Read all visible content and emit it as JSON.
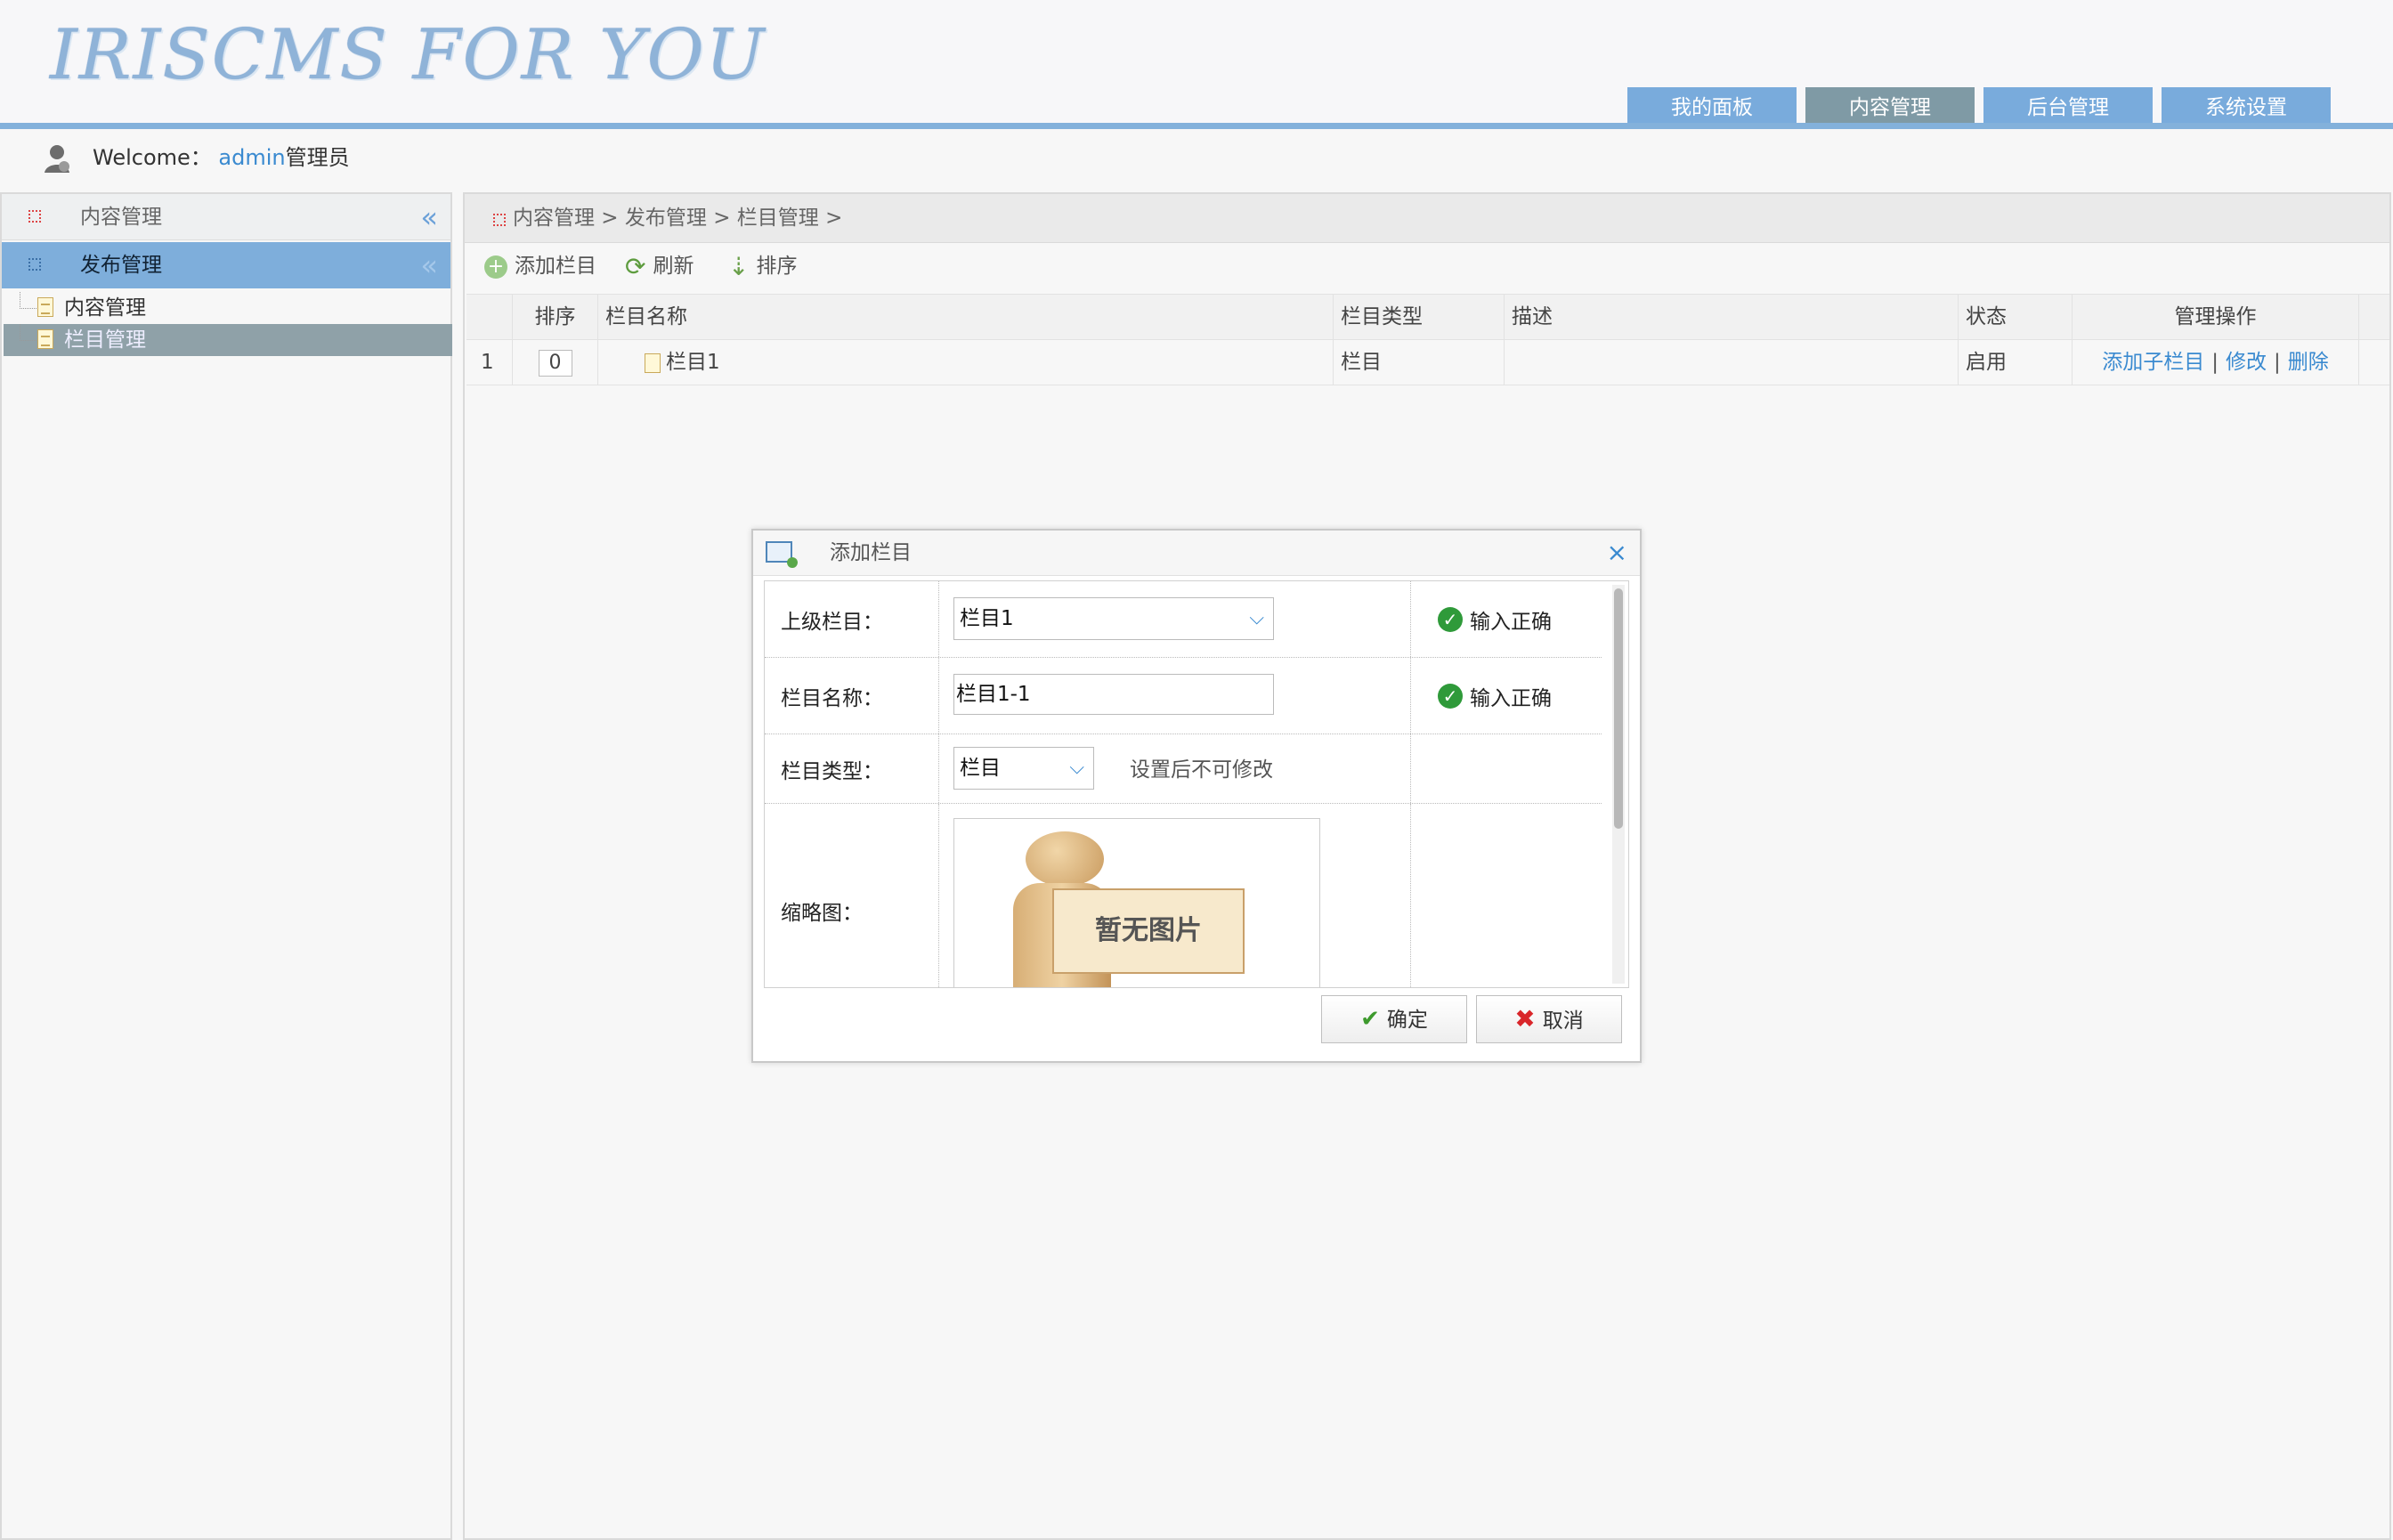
{
  "header": {
    "logo_text": "IRISCMS FOR YOU",
    "nav_tabs": [
      {
        "label": "我的面板",
        "active": false
      },
      {
        "label": "内容管理",
        "active": true
      },
      {
        "label": "后台管理",
        "active": false
      },
      {
        "label": "系统设置",
        "active": false
      }
    ],
    "accent_color": "#79abdc"
  },
  "welcome": {
    "prefix": "Welcome：",
    "user": "admin",
    "role": "管理员"
  },
  "sidebar": {
    "section_title": "内容管理",
    "group_title": "发布管理",
    "items": [
      {
        "label": "内容管理",
        "selected": false
      },
      {
        "label": "栏目管理",
        "selected": true
      }
    ]
  },
  "main": {
    "breadcrumb": "内容管理 > 发布管理 > 栏目管理 >",
    "toolbar": {
      "add_label": "添加栏目",
      "refresh_label": "刷新",
      "sort_label": "排序"
    },
    "table": {
      "headers": {
        "sort": "排序",
        "name": "栏目名称",
        "type": "栏目类型",
        "desc": "描述",
        "status": "状态",
        "ops": "管理操作"
      },
      "rows": [
        {
          "num": "1",
          "sort": "0",
          "name": "栏目1",
          "type": "栏目",
          "desc": "",
          "status": "启用",
          "op_add_child": "添加子栏目",
          "op_edit": "修改",
          "op_delete": "删除"
        }
      ]
    }
  },
  "dialog": {
    "title": "添加栏目",
    "fields": {
      "parent_label": "上级栏目：",
      "parent_value": "栏目1",
      "parent_tip": "输入正确",
      "name_label": "栏目名称：",
      "name_value": "栏目1-1",
      "name_tip": "输入正确",
      "type_label": "栏目类型：",
      "type_value": "栏目",
      "type_note": "设置后不可修改",
      "thumb_label": "缩略图：",
      "thumb_placeholder": "暂无图片"
    },
    "ok_label": "确定",
    "cancel_label": "取消"
  }
}
